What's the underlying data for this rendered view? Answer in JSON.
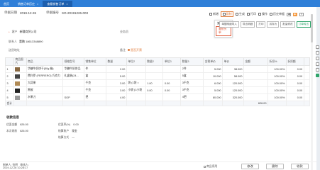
{
  "tabs": [
    {
      "label": "首页"
    },
    {
      "label": "销售订单历史"
    },
    {
      "label": "查看销售订单"
    }
  ],
  "header": {
    "date_label": "单据日期",
    "date_value": "2019-12-26",
    "no_label": "单据编号",
    "no_value": "SO-20191226-003"
  },
  "toolbar": {
    "new": "新增",
    "copy": "复制",
    "build": "生成",
    "print": "打印",
    "ops": "操作",
    "history": "历史单据",
    "nav_prev": "◀",
    "nav_next": "▶",
    "close": "×"
  },
  "popup": {
    "items": [
      "复制单据",
      "复制另单"
    ]
  },
  "actions": [
    "单据明细导入",
    "导出明细",
    "打印",
    "另存为",
    "批量修改",
    "订单转出"
  ],
  "fields": {
    "customer_label": "客户",
    "customer_value": "新疆商贸公司",
    "salesman_label": "业务员",
    "salesman_value": "",
    "contact_label": "联系人",
    "contact_value": "董鹏 18613348890",
    "address_label": "送货地址",
    "address_value": "",
    "remark_label": "备注",
    "invoice_text": "是否开票"
  },
  "table": {
    "headers": [
      "",
      "商品图片",
      "商品",
      "规格型号",
      "销售单位",
      "数量",
      "单位2",
      "数量2",
      "单位3",
      "数量3",
      "含税单价",
      "单价",
      "金额",
      "折扣%",
      "折扣额",
      ""
    ],
    "rows": [
      [
        "1",
        "",
        "华糖牛奶饼干(50g 箱)",
        "华糖牛奶饼品",
        "件",
        "2.00",
        "",
        "",
        "",
        "2件",
        "5.000",
        "38.000",
        "",
        "100.00%",
        "0.00",
        ""
      ],
      [
        "2",
        "",
        "费利罗 (FERRERO) 巧克力",
        "礼盒装(24...",
        "盒",
        "5.00",
        "",
        "",
        "",
        "5盒",
        "10.000",
        "58.000",
        "",
        "100.00%",
        "0.00",
        ""
      ],
      [
        "3",
        "",
        "大蒜果",
        "",
        "千克",
        "3.00",
        "袋 (1袋 =",
        "1.00",
        "0.00",
        "3千克",
        "6.000",
        "120.000",
        "",
        "100.00%",
        "0.00",
        ""
      ],
      [
        "4",
        "",
        "黑椒",
        "",
        "千克",
        "3.00",
        "小袋 (1小袋",
        "0.00",
        "0.00",
        "3千克",
        "5.000",
        "120.000",
        "",
        "100.00%",
        "0.00",
        ""
      ],
      [
        "5",
        "",
        "水果刀",
        "SGP",
        "把",
        "4.00",
        "",
        "",
        "",
        "4把",
        "80.000",
        "320.000",
        "",
        "100.00%",
        "0.00",
        ""
      ]
    ],
    "total_label": "合计",
    "total_amount": "626.00"
  },
  "summary": {
    "title": "收款信息",
    "discount_amount_label": "优惠金额",
    "discount_amount": "626.00",
    "discount_rate_label": "优惠率(%)",
    "discount_rate": "0.00",
    "paid_label": "本次收款",
    "paid": "626.00",
    "account_label": "结算账户",
    "account_value": "现金",
    "method_label": "结算方式",
    "method_value": "—"
  },
  "footer": {
    "maker": "制单人: 张明",
    "time": "2019-12-26 10:28:17",
    "audit_label": "审核人:",
    "hide_label": "商品停用",
    "btn1": "修改",
    "btn2": "删除",
    "btn3": "收款"
  }
}
